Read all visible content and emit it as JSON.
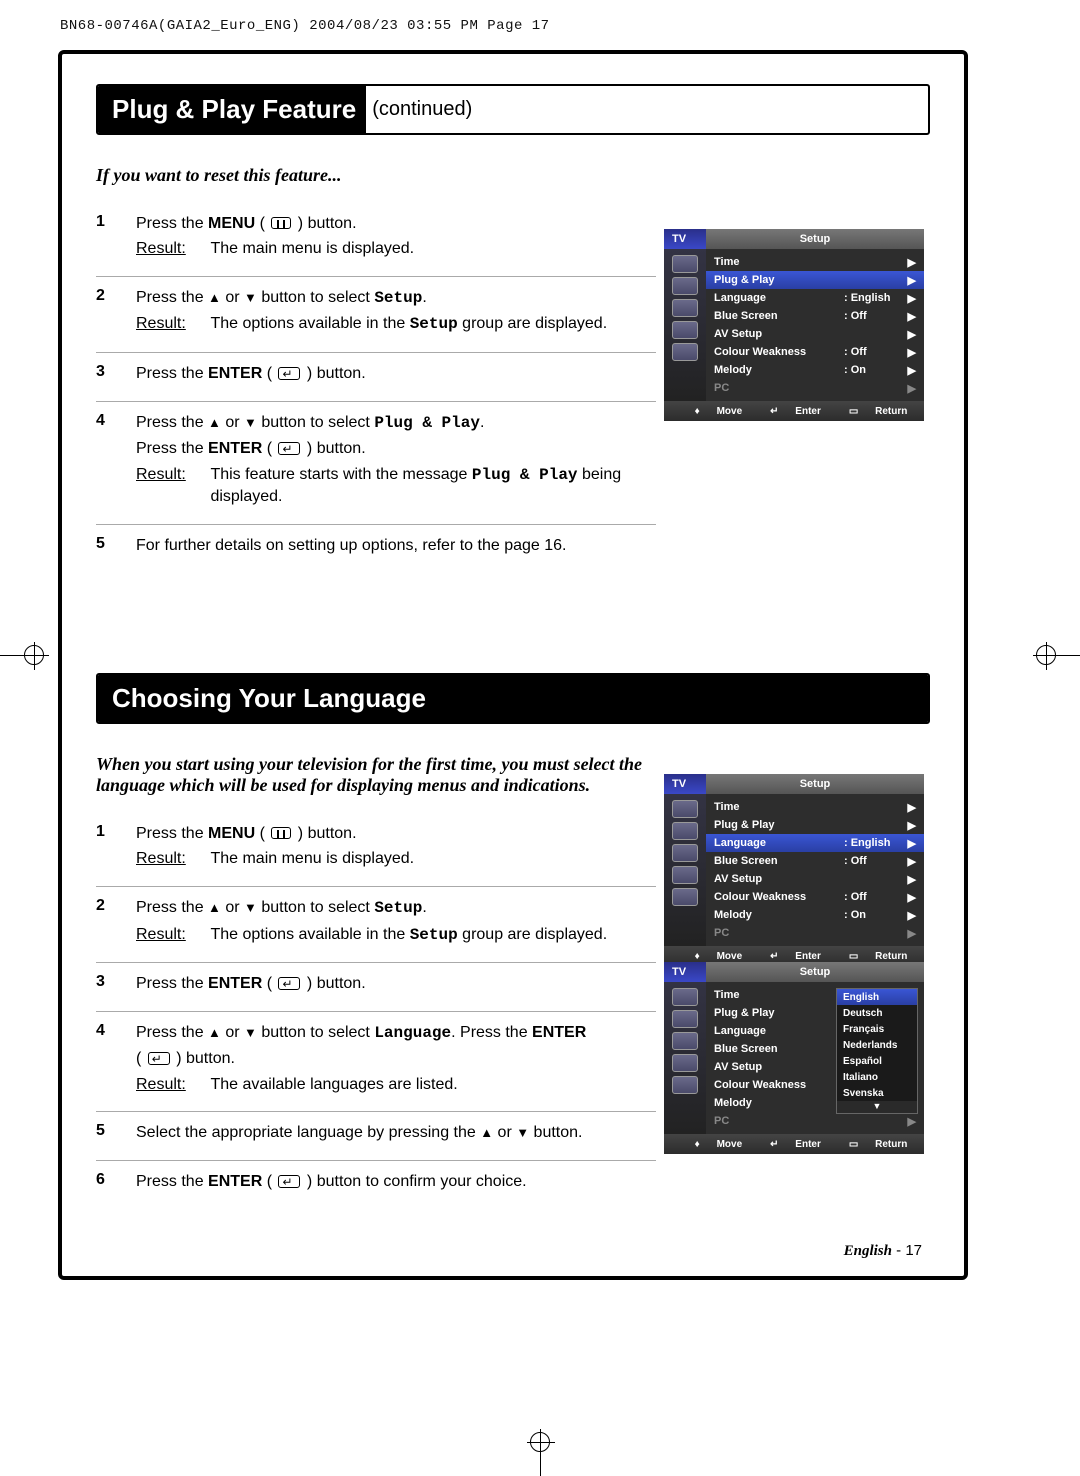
{
  "header": {
    "meta_line": "BN68-00746A(GAIA2_Euro_ENG)  2004/08/23  03:55 PM  Page 17"
  },
  "section1": {
    "title_main": "Plug & Play Feature",
    "title_cont": "(continued)",
    "intro": "If you want to reset this feature...",
    "steps": [
      {
        "n": "1",
        "lines": [
          [
            {
              "t": "Press the "
            },
            {
              "t": "MENU",
              "cls": "bold"
            },
            {
              "t": " ( "
            },
            {
              "icon": "menu"
            },
            {
              "t": " ) button."
            }
          ]
        ],
        "result": "The main menu is displayed."
      },
      {
        "n": "2",
        "lines": [
          [
            {
              "t": "Press the "
            },
            {
              "t": "▲",
              "cls": "up"
            },
            {
              "t": " or "
            },
            {
              "t": "▼",
              "cls": "dn"
            },
            {
              "t": " button to select "
            },
            {
              "t": "Setup",
              "cls": "mono"
            },
            {
              "t": "."
            }
          ]
        ],
        "result": [
          {
            "t": "The options available in the "
          },
          {
            "t": "Setup",
            "cls": "mono"
          },
          {
            "t": " group are displayed."
          }
        ]
      },
      {
        "n": "3",
        "lines": [
          [
            {
              "t": "Press the "
            },
            {
              "t": "ENTER",
              "cls": "bold"
            },
            {
              "t": " ( "
            },
            {
              "icon": "enter"
            },
            {
              "t": " ) button."
            }
          ]
        ]
      },
      {
        "n": "4",
        "lines": [
          [
            {
              "t": "Press the "
            },
            {
              "t": "▲",
              "cls": "up"
            },
            {
              "t": " or "
            },
            {
              "t": "▼",
              "cls": "dn"
            },
            {
              "t": " button to select "
            },
            {
              "t": "Plug & Play",
              "cls": "mono"
            },
            {
              "t": "."
            }
          ],
          [
            {
              "t": "Press the "
            },
            {
              "t": "ENTER",
              "cls": "bold"
            },
            {
              "t": " ( "
            },
            {
              "icon": "enter"
            },
            {
              "t": " ) button."
            }
          ]
        ],
        "result": [
          {
            "t": "This feature starts with the message "
          },
          {
            "t": "Plug & Play",
            "cls": "mono"
          },
          {
            "t": " being displayed."
          }
        ]
      },
      {
        "n": "5",
        "lines": [
          [
            {
              "t": "For further details on setting up options, refer to the page 16."
            }
          ]
        ]
      }
    ]
  },
  "section2": {
    "title_main": "Choosing Your Language",
    "intro": "When you start using your television for the first time, you must select the language which will be used for displaying menus and indications.",
    "steps": [
      {
        "n": "1",
        "lines": [
          [
            {
              "t": "Press the "
            },
            {
              "t": "MENU",
              "cls": "bold"
            },
            {
              "t": " ( "
            },
            {
              "icon": "menu"
            },
            {
              "t": " ) button."
            }
          ]
        ],
        "result": "The main menu is displayed."
      },
      {
        "n": "2",
        "lines": [
          [
            {
              "t": "Press the "
            },
            {
              "t": "▲",
              "cls": "up"
            },
            {
              "t": " or "
            },
            {
              "t": "▼",
              "cls": "dn"
            },
            {
              "t": " button to select "
            },
            {
              "t": "Setup",
              "cls": "mono"
            },
            {
              "t": "."
            }
          ]
        ],
        "result": [
          {
            "t": "The options available in the "
          },
          {
            "t": "Setup",
            "cls": "mono"
          },
          {
            "t": " group are displayed."
          }
        ]
      },
      {
        "n": "3",
        "lines": [
          [
            {
              "t": "Press the "
            },
            {
              "t": "ENTER",
              "cls": "bold"
            },
            {
              "t": " ( "
            },
            {
              "icon": "enter"
            },
            {
              "t": " ) button."
            }
          ]
        ]
      },
      {
        "n": "4",
        "lines": [
          [
            {
              "t": "Press the "
            },
            {
              "t": "▲",
              "cls": "up"
            },
            {
              "t": " or "
            },
            {
              "t": "▼",
              "cls": "dn"
            },
            {
              "t": " button to select "
            },
            {
              "t": "Language",
              "cls": "mono"
            },
            {
              "t": ". Press the "
            },
            {
              "t": "ENTER",
              "cls": "bold"
            }
          ],
          [
            {
              "t": "( "
            },
            {
              "icon": "enter"
            },
            {
              "t": " ) button."
            }
          ]
        ],
        "result": "The available languages are listed."
      },
      {
        "n": "5",
        "lines": [
          [
            {
              "t": "Select the appropriate language by pressing the "
            },
            {
              "t": "▲",
              "cls": "up"
            },
            {
              "t": " or "
            },
            {
              "t": "▼",
              "cls": "dn"
            },
            {
              "t": " button."
            }
          ]
        ]
      },
      {
        "n": "6",
        "lines": [
          [
            {
              "t": "Press the "
            },
            {
              "t": "ENTER",
              "cls": "bold"
            },
            {
              "t": " ( "
            },
            {
              "icon": "enter"
            },
            {
              "t": " ) button to confirm your choice."
            }
          ]
        ]
      }
    ]
  },
  "osd_common": {
    "tv": "TV",
    "title": "Setup",
    "footer": {
      "move": "Move",
      "enter": "Enter",
      "return": "Return"
    }
  },
  "osd1": {
    "rows": [
      {
        "lbl": "Time",
        "val": "",
        "hl": false
      },
      {
        "lbl": "Plug & Play",
        "val": "",
        "hl": true
      },
      {
        "lbl": "Language",
        "val": ": English",
        "hl": false
      },
      {
        "lbl": "Blue Screen",
        "val": ": Off",
        "hl": false
      },
      {
        "lbl": "AV Setup",
        "val": "",
        "hl": false
      },
      {
        "lbl": "Colour Weakness",
        "val": ": Off",
        "hl": false
      },
      {
        "lbl": "Melody",
        "val": ": On",
        "hl": false
      },
      {
        "lbl": "PC",
        "val": "",
        "hl": false,
        "dim": true
      }
    ]
  },
  "osd2": {
    "rows": [
      {
        "lbl": "Time",
        "val": "",
        "hl": false
      },
      {
        "lbl": "Plug & Play",
        "val": "",
        "hl": false
      },
      {
        "lbl": "Language",
        "val": ": English",
        "hl": true
      },
      {
        "lbl": "Blue Screen",
        "val": ": Off",
        "hl": false
      },
      {
        "lbl": "AV Setup",
        "val": "",
        "hl": false
      },
      {
        "lbl": "Colour Weakness",
        "val": ": Off",
        "hl": false
      },
      {
        "lbl": "Melody",
        "val": ": On",
        "hl": false
      },
      {
        "lbl": "PC",
        "val": "",
        "hl": false,
        "dim": true
      }
    ]
  },
  "osd3": {
    "rows": [
      {
        "lbl": "Time",
        "val": ":",
        "hl": false
      },
      {
        "lbl": "Plug & Play",
        "val": "",
        "hl": false
      },
      {
        "lbl": "Language",
        "val": ":",
        "hl": false
      },
      {
        "lbl": "Blue Screen",
        "val": ":",
        "hl": false
      },
      {
        "lbl": "AV Setup",
        "val": "",
        "hl": false
      },
      {
        "lbl": "Colour Weakness",
        "val": ":",
        "hl": false
      },
      {
        "lbl": "Melody",
        "val": ":",
        "hl": false
      },
      {
        "lbl": "PC",
        "val": "",
        "hl": false,
        "dim": true
      }
    ],
    "popup": [
      "English",
      "Deutsch",
      "Français",
      "Nederlands",
      "Español",
      "Italiano",
      "Svenska"
    ],
    "popup_hl": 0
  },
  "footer": {
    "lang": "English",
    "page": "17",
    "result_label": "Result:"
  }
}
